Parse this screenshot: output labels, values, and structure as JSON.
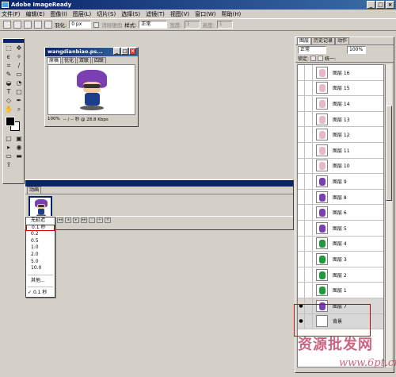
{
  "app": {
    "title": "Adobe ImageReady"
  },
  "menu": [
    "文件(F)",
    "编辑(E)",
    "图像(I)",
    "图层(L)",
    "切片(S)",
    "选择(S)",
    "滤镜(T)",
    "视图(V)",
    "窗口(W)",
    "帮助(H)"
  ],
  "options": {
    "feather_label": "羽化:",
    "feather_value": "0 px",
    "antialias_label": "消除锯齿",
    "style_label": "样式:",
    "style_value": "正常",
    "width_label": "宽度:",
    "width_value": "1",
    "height_label": "高度:",
    "height_value": "1"
  },
  "doc": {
    "title": "wangdianbiao.ps...",
    "tabs": [
      "原稿",
      "优化",
      "双联",
      "四联"
    ],
    "zoom": "100%",
    "status": "-- / -- 秒 @ 28.8 Kbps"
  },
  "animation": {
    "title": "动画",
    "tabs": [
      "动画"
    ],
    "frame_number": "1"
  },
  "delay_menu": {
    "items": [
      "无延迟",
      "0.1 秒",
      "0.2",
      "0.5",
      "1.0",
      "2.0",
      "5.0",
      "10.0"
    ],
    "selected": "0.1 秒",
    "other": "其他...",
    "checked": "0.1 秒"
  },
  "layers_panel": {
    "tabs": [
      "图层",
      "历史记录",
      "动作"
    ],
    "blend_mode": "正常",
    "opacity": "100%",
    "lock_label": "锁定:",
    "unify_label": "统一:",
    "layers": [
      {
        "name": "图层 16",
        "color": "#e9b7c9"
      },
      {
        "name": "图层 15",
        "color": "#e9b7c9"
      },
      {
        "name": "图层 14",
        "color": "#e9b7c9"
      },
      {
        "name": "图层 13",
        "color": "#e9b7c9"
      },
      {
        "name": "图层 12",
        "color": "#e9b7c9"
      },
      {
        "name": "图层 11",
        "color": "#e9b7c9"
      },
      {
        "name": "图层 10",
        "color": "#e9b7c9"
      },
      {
        "name": "图层 9",
        "color": "#7a3fb0"
      },
      {
        "name": "图层 8",
        "color": "#7a3fb0"
      },
      {
        "name": "图层 6",
        "color": "#7a3fb0"
      },
      {
        "name": "图层 5",
        "color": "#7a3fb0"
      },
      {
        "name": "图层 4",
        "color": "#1f9a3a"
      },
      {
        "name": "图层 3",
        "color": "#1f9a3a"
      },
      {
        "name": "图层 2",
        "color": "#1f9a3a"
      },
      {
        "name": "图层 1",
        "color": "#1f9a3a"
      },
      {
        "name": "图层 7",
        "color": "#7a3fb0"
      },
      {
        "name": "背景",
        "color": "#ffffff"
      }
    ]
  },
  "watermark": {
    "line1": "资源批发网",
    "line2": "www.6pt.cn"
  }
}
